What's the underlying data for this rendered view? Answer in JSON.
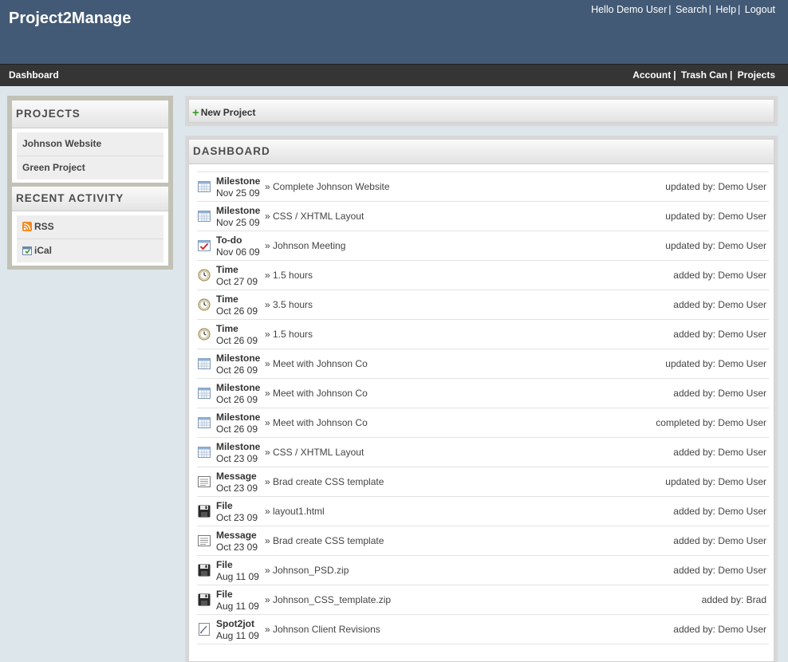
{
  "app": {
    "title": "Project2Manage"
  },
  "top_links": [
    "Hello Demo User",
    "Search",
    "Help",
    "Logout"
  ],
  "nav": {
    "current": "Dashboard",
    "links": [
      "Account",
      "Trash Can",
      "Projects"
    ]
  },
  "sidebar": {
    "projects_title": "PROJECTS",
    "projects": [
      "Johnson Website",
      "Green Project"
    ],
    "activity_title": "RECENT ACTIVITY",
    "activity": [
      {
        "label": "RSS",
        "icon": "rss-icon"
      },
      {
        "label": "iCal",
        "icon": "ical-icon"
      }
    ]
  },
  "new_project_label": "New Project",
  "dashboard": {
    "title": "DASHBOARD",
    "rows": [
      {
        "icon": "milestone-icon",
        "type": "Milestone",
        "date": "Nov 25 09",
        "desc": "» Complete Johnson Website",
        "by": "updated by: Demo User"
      },
      {
        "icon": "milestone-icon",
        "type": "Milestone",
        "date": "Nov 25 09",
        "desc": "» CSS / XHTML Layout",
        "by": "updated by: Demo User"
      },
      {
        "icon": "todo-icon",
        "type": "To-do",
        "date": "Nov 06 09",
        "desc": "» Johnson Meeting",
        "by": "updated by: Demo User"
      },
      {
        "icon": "time-icon",
        "type": "Time",
        "date": "Oct 27 09",
        "desc": "» 1.5 hours",
        "by": "added by: Demo User"
      },
      {
        "icon": "time-icon",
        "type": "Time",
        "date": "Oct 26 09",
        "desc": "» 3.5 hours",
        "by": "added by: Demo User"
      },
      {
        "icon": "time-icon",
        "type": "Time",
        "date": "Oct 26 09",
        "desc": "» 1.5 hours",
        "by": "added by: Demo User"
      },
      {
        "icon": "milestone-icon",
        "type": "Milestone",
        "date": "Oct 26 09",
        "desc": "» Meet with Johnson Co",
        "by": "updated by: Demo User"
      },
      {
        "icon": "milestone-icon",
        "type": "Milestone",
        "date": "Oct 26 09",
        "desc": "» Meet with Johnson Co",
        "by": "added by: Demo User"
      },
      {
        "icon": "milestone-icon",
        "type": "Milestone",
        "date": "Oct 26 09",
        "desc": "» Meet with Johnson Co",
        "by": "completed by: Demo User"
      },
      {
        "icon": "milestone-icon",
        "type": "Milestone",
        "date": "Oct 23 09",
        "desc": "» CSS / XHTML Layout",
        "by": "added by: Demo User"
      },
      {
        "icon": "message-icon",
        "type": "Message",
        "date": "Oct 23 09",
        "desc": "» Brad create CSS template",
        "by": "updated by: Demo User"
      },
      {
        "icon": "file-icon",
        "type": "File",
        "date": "Oct 23 09",
        "desc": "» layout1.html",
        "by": "added by: Demo User"
      },
      {
        "icon": "message-icon",
        "type": "Message",
        "date": "Oct 23 09",
        "desc": "» Brad create CSS template",
        "by": "added by: Demo User"
      },
      {
        "icon": "file-icon",
        "type": "File",
        "date": "Aug 11 09",
        "desc": "» Johnson_PSD.zip",
        "by": "added by: Demo User"
      },
      {
        "icon": "file-icon",
        "type": "File",
        "date": "Aug 11 09",
        "desc": "» Johnson_CSS_template.zip",
        "by": "added by: Brad"
      },
      {
        "icon": "spot2jot-icon",
        "type": "Spot2jot",
        "date": "Aug 11 09",
        "desc": "» Johnson Client Revisions",
        "by": "added by: Demo User"
      }
    ]
  }
}
